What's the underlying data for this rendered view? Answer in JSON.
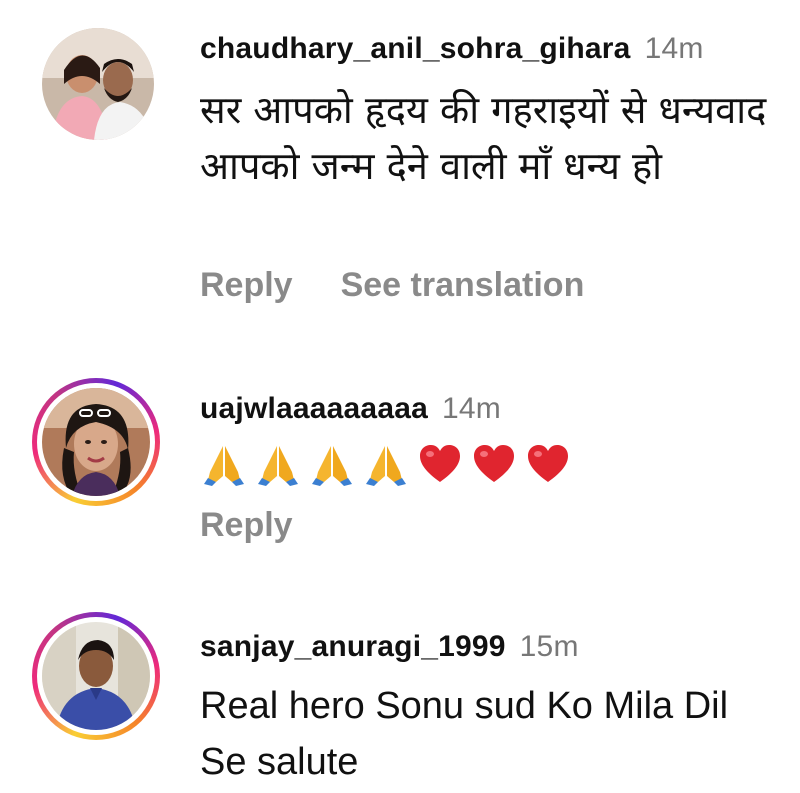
{
  "comments": [
    {
      "username": "chaudhary_anil_sohra_gihara",
      "time": "14m",
      "text": "सर आपको हृदय की गहराइयों से धन्यवाद आपको जन्म देने वाली माँ धन्य हो",
      "reply_label": "Reply",
      "translate_label": "See translation"
    },
    {
      "username": "uajwlaaaaaaaaa",
      "time": "14m",
      "emojis": [
        "folded-hands",
        "folded-hands",
        "folded-hands",
        "folded-hands",
        "red-heart",
        "red-heart",
        "red-heart"
      ],
      "reply_label": "Reply"
    },
    {
      "username": "sanjay_anuragi_1999",
      "time": "15m",
      "text": "Real hero Sonu sud Ko Mila Dil Se salute"
    }
  ],
  "colors": {
    "text": "#111111",
    "muted": "#8a8a8a",
    "timestamp": "#777777",
    "heart": "#e0252f",
    "hands": "#f5b52e"
  }
}
